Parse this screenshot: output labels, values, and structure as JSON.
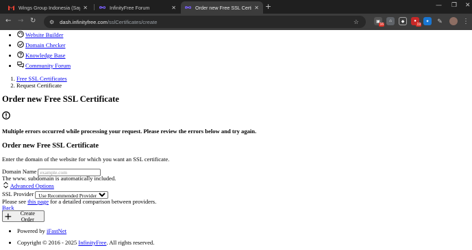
{
  "browser": {
    "tabs": [
      {
        "title": "Wings Group Indonesia (Sayap",
        "favicon": "gmail-icon"
      },
      {
        "title": "InfinityFree Forum",
        "favicon": "infinityfree-icon"
      },
      {
        "title": "Order new Free SSL Certificate",
        "favicon": "infinityfree-icon",
        "active": true
      }
    ],
    "url_host": "dash.infinityfree.com",
    "url_path": "/sslCertificates/create",
    "extension_badges": [
      "16",
      "19"
    ]
  },
  "nav_links": [
    {
      "label": "Website Builder",
      "icon": "palette-icon"
    },
    {
      "label": "Domain Checker",
      "icon": "check-circle-icon"
    },
    {
      "label": "Knowledge Base",
      "icon": "help-circle-icon"
    },
    {
      "label": "Community Forum",
      "icon": "chat-icon"
    }
  ],
  "breadcrumb": {
    "items": [
      "Free SSL Certificates",
      "Request Certificate"
    ]
  },
  "page_title": "Order new Free SSL Certificate",
  "error_message": "Multiple errors occurred while processing your request. Please review the errors below and try again.",
  "form": {
    "heading": "Order new Free SSL Certificate",
    "description": "Enter the domain of the website for which you want an SSL certificate.",
    "domain_label": "Domain Name",
    "domain_placeholder": "example.com",
    "domain_value": "",
    "domain_hint": "The www. subdomain is automatically included.",
    "advanced_label": "Advanced Options",
    "provider_label": "SSL Provider",
    "provider_selected": "Use Recommended Provider",
    "see_prefix": "Please see",
    "see_link": "this page",
    "see_suffix": "for a detailed comparison between providers.",
    "back_label": "Back",
    "submit_label": "Create Order"
  },
  "footer": {
    "powered_prefix": "Powered by",
    "powered_link": "iFastNet",
    "copyright_prefix": "Copyright © 2016 - 2025",
    "copyright_link": "InfinityFree",
    "copyright_suffix": ". All rights reserved."
  },
  "colors": {
    "link": "#0000ee",
    "tabbar": "#1f1f1f",
    "toolbar": "#3c3c3c"
  }
}
